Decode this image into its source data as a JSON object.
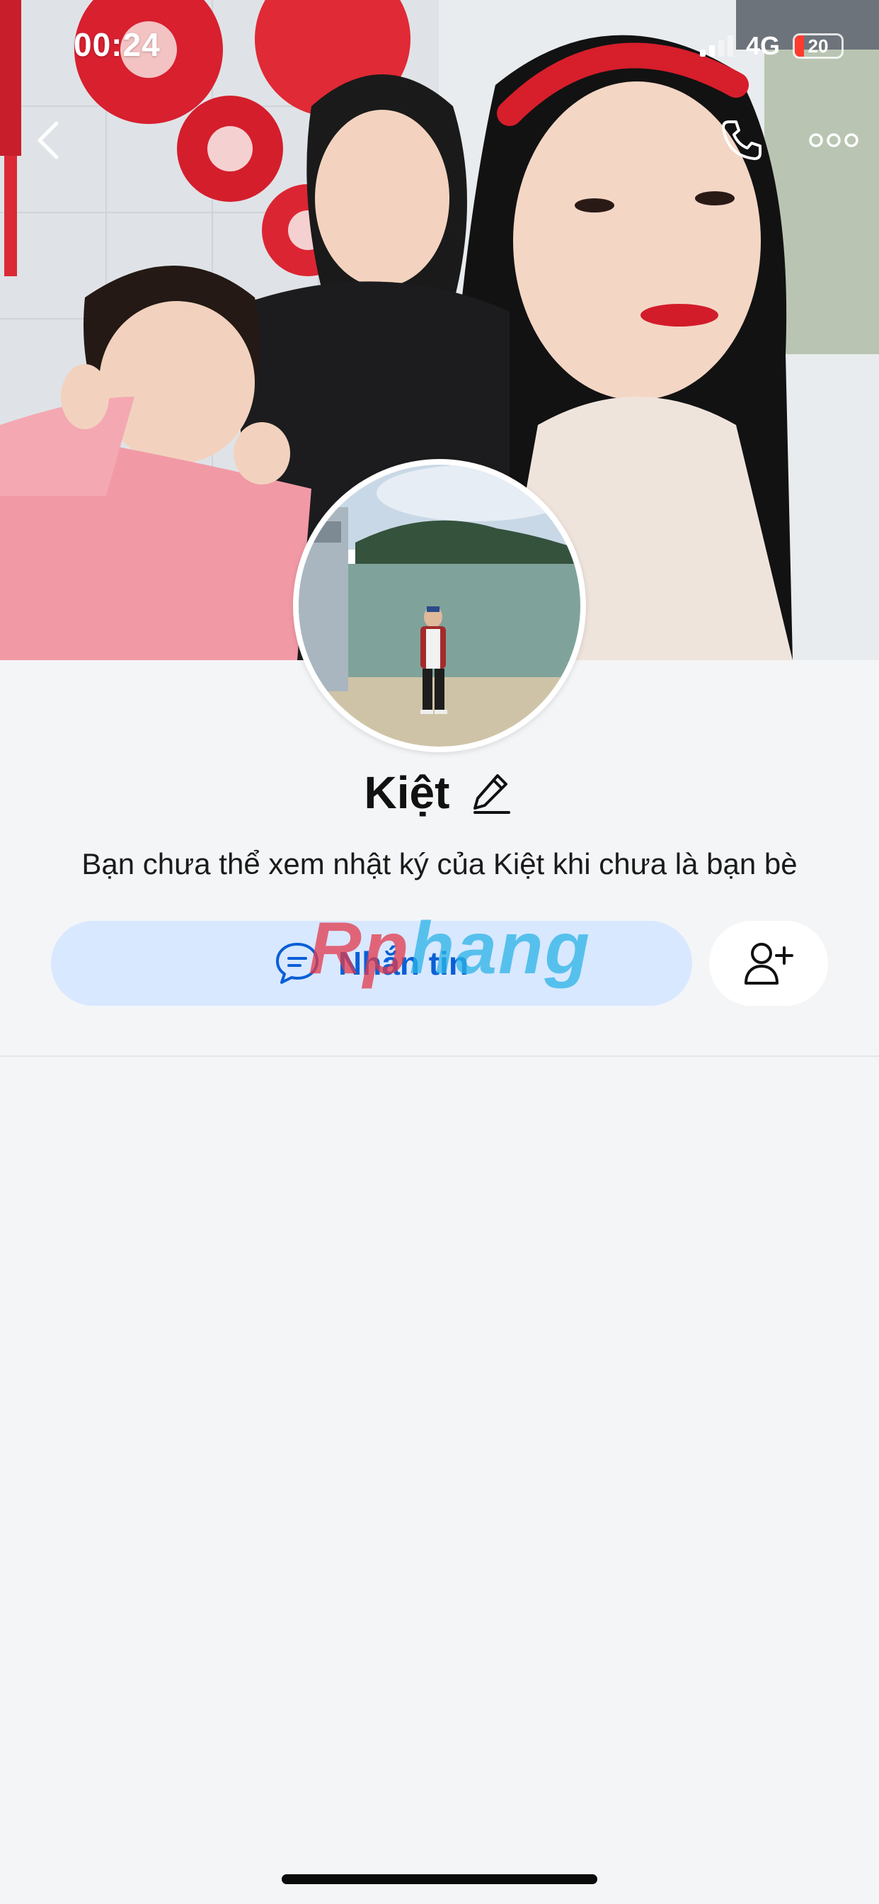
{
  "status_bar": {
    "time": "00:24",
    "network": "4G",
    "battery": "20",
    "battery_level": 0.2
  },
  "header": {
    "back_icon": "chevron-left-icon",
    "call_icon": "phone-icon",
    "more_icon": "more-options-icon"
  },
  "profile": {
    "name": "Kiệt",
    "edit_icon": "pencil-icon",
    "privacy_notice": "Bạn chưa thể xem nhật ký của Kiệt khi chưa là bạn bè"
  },
  "actions": {
    "message_label": "Nhắn tin",
    "message_icon": "chat-bubble-icon",
    "add_friend_icon": "add-friend-icon"
  },
  "watermark": {
    "part1": "Rp",
    "part2": "hang"
  },
  "colors": {
    "accent": "#0a5fd6",
    "message_button_bg": "#d8e8ff",
    "background": "#f4f5f7"
  }
}
